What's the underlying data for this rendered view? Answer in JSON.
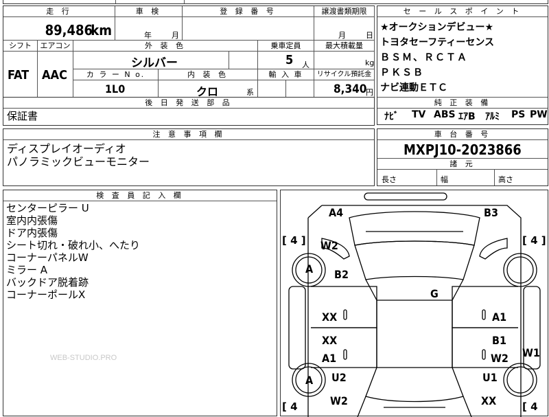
{
  "top_strip": [
    "",
    "",
    "",
    ""
  ],
  "headers": {
    "mileage": "走 行",
    "inspection": "車 検",
    "reg_number": "登 録 番 号",
    "transfer_limit": "譲渡書類期限",
    "shift": "シフト",
    "aircon": "エアコン",
    "exterior_color": "外 装 色",
    "capacity": "乗車定員",
    "max_load": "最大積載量",
    "color_no": "カ ラ ー N o.",
    "interior_color": "内 装 色",
    "import": "輸 入 車",
    "recycle": "リサイクル預託金",
    "later_parts": "後 日 発 送 部 品",
    "notes": "注 意 事 項 欄",
    "sales_points": "セ ー ル ス ポ イ ン ト",
    "equipment": "純 正 装 備",
    "chassis": "車 台 番 号",
    "dimensions": "諸 元",
    "inspector": "検 査 員 記 入 欄"
  },
  "values": {
    "mileage": "89,486",
    "mileage_unit": "km",
    "year_unit": "年",
    "month_unit": "月",
    "day_unit": "日",
    "shift": "FAT",
    "aircon": "AAC",
    "exterior_color": "シルバー",
    "capacity": "5",
    "capacity_unit": "人",
    "load_unit": "kg",
    "color_no": "1L0",
    "interior_color": "クロ",
    "interior_suffix": "系",
    "recycle": "8,340",
    "recycle_unit": "円",
    "later_parts": "保証書",
    "chassis": "MXPJ10-2023866",
    "length": "長さ",
    "width": "幅",
    "height": "高さ"
  },
  "sales_points": [
    "★オークションデビュー★",
    "トヨタセーフティーセンス",
    "ＢＳＭ、ＲＣＴＡ",
    "ＰＫＳＢ",
    "ナビ連動ＥＴＣ"
  ],
  "equipment": [
    "ﾅﾋﾞ",
    "TV",
    "ABS",
    "ｴｱB",
    "ｱﾙﾐ",
    "PS",
    "PW"
  ],
  "notes": [
    "ディスプレイオーディオ",
    "パノラミックビューモニター"
  ],
  "inspector_notes": [
    "センターピラー U",
    "室内内張傷",
    "ドア内張傷",
    "シート切れ・破れ小、へたり",
    "コーナーパネルW",
    "ミラー A",
    "バックドア脱着跡",
    "コーナーポールX"
  ],
  "watermark": "WEB-STUDIO.PRO",
  "diagram": {
    "tire_left_top": "[ 4 ]",
    "tire_right_top": "[ 4 ]",
    "tire_left_bottom": "[ 4",
    "tire_right_bottom": "[ 4",
    "marks": {
      "a4": "A4",
      "b3": "B3",
      "w2_top": "W2",
      "a_top": "A",
      "b2": "B2",
      "g": "G",
      "xx_left1": "XX",
      "a1_right1": "A1",
      "xx_left2": "XX",
      "b1_right": "B1",
      "a1_left": "A1",
      "w2_right": "W2",
      "w1": "W1",
      "a_bottom": "A",
      "u2": "U2",
      "u1": "U1",
      "w2_bottom": "W2",
      "xx_bottom": "XX"
    }
  }
}
